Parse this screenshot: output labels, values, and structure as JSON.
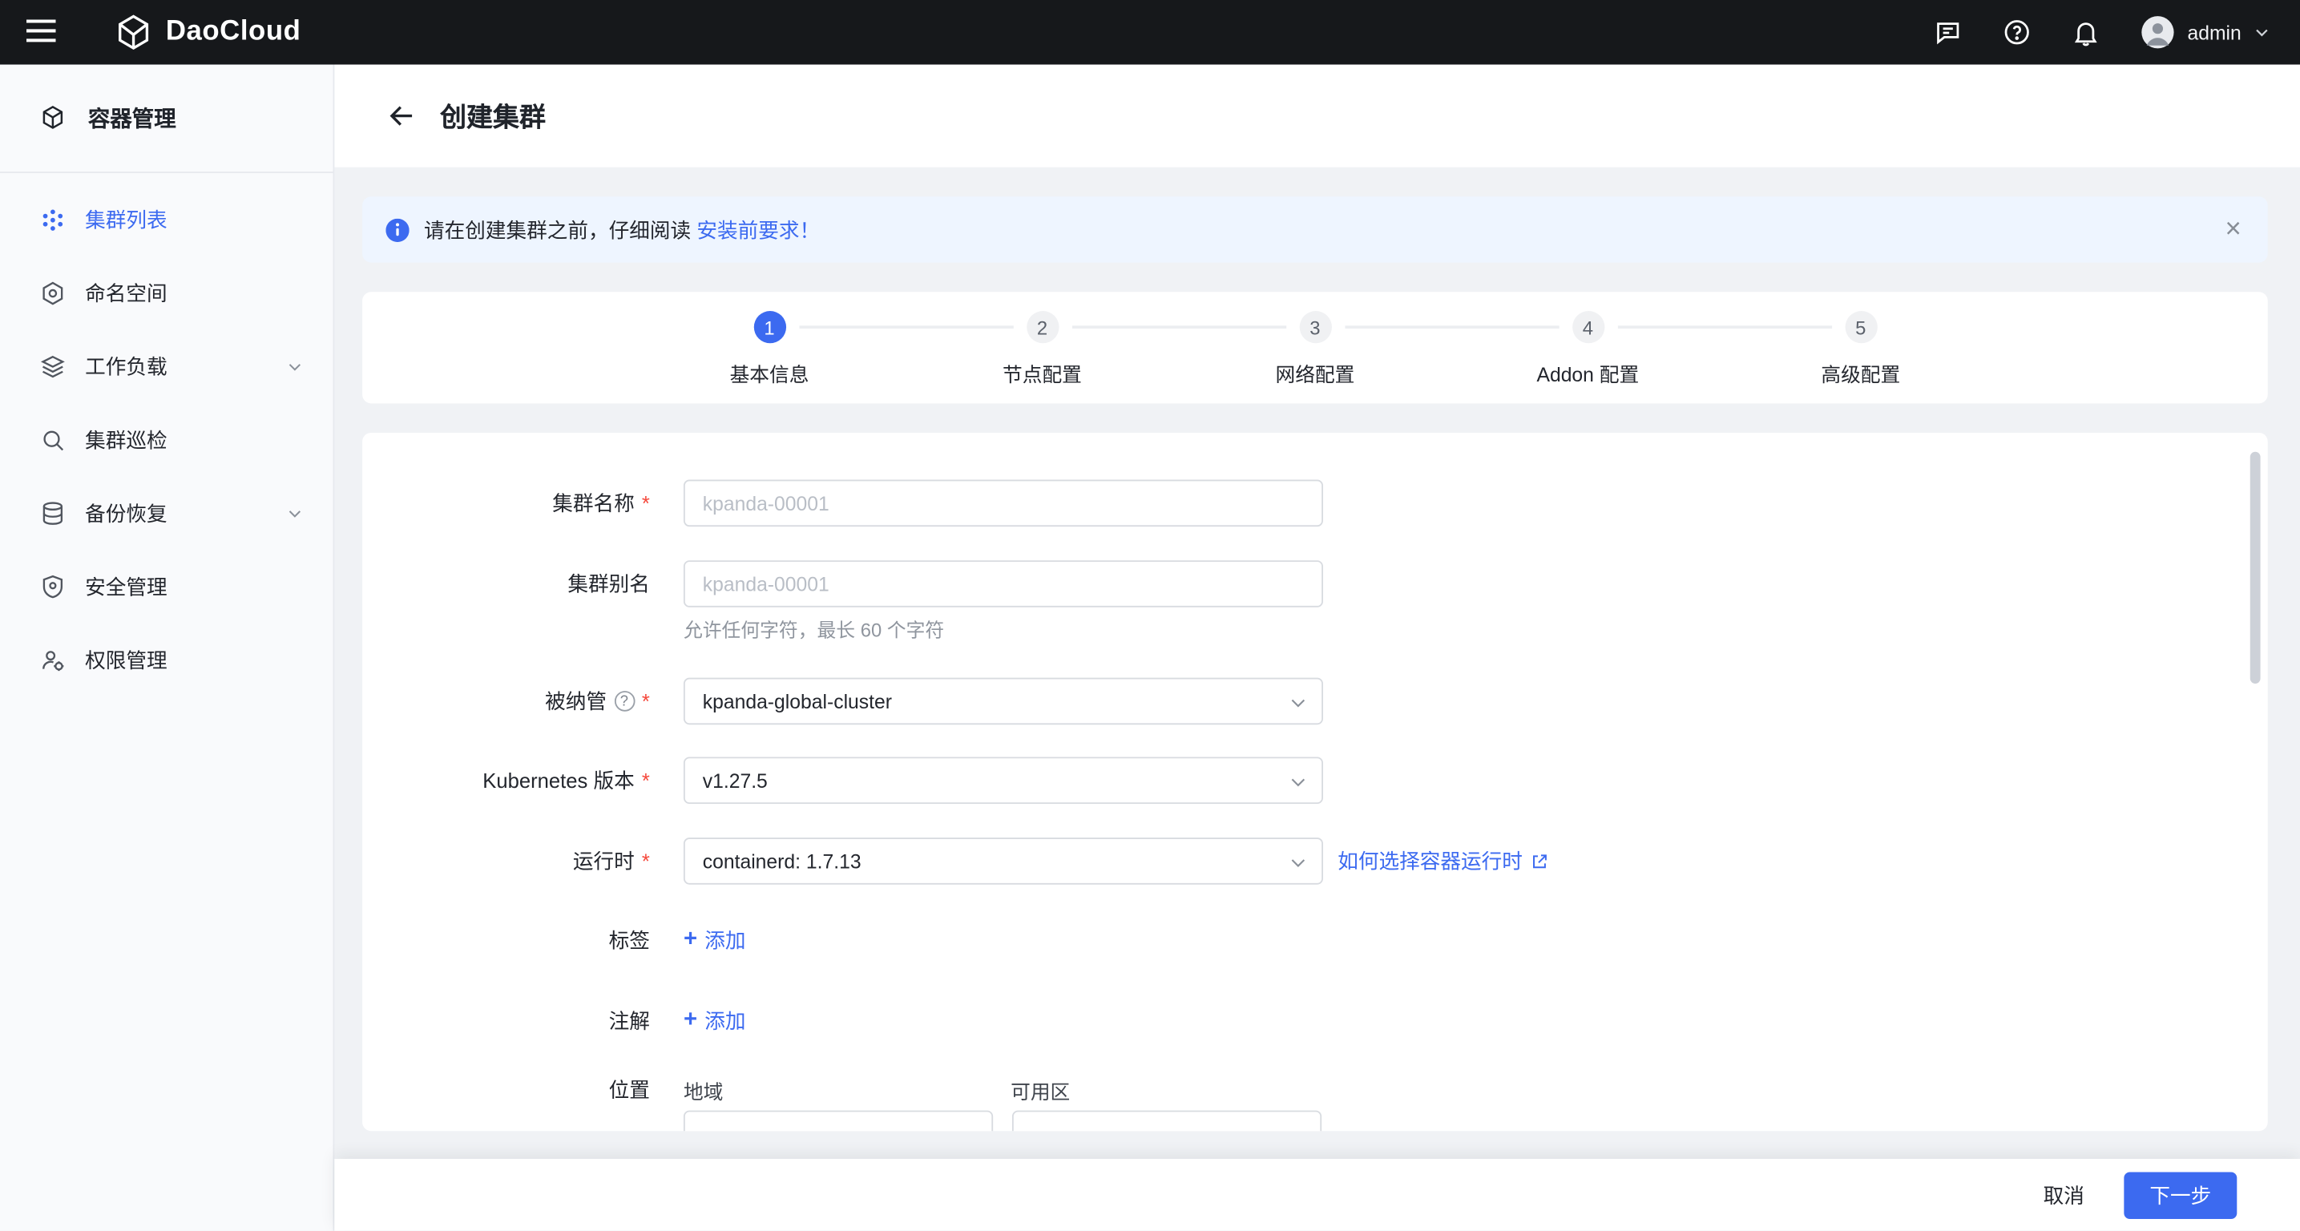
{
  "topbar": {
    "brand": "DaoCloud",
    "user": "admin"
  },
  "sidebar": {
    "title": "容器管理",
    "items": [
      {
        "label": "集群列表"
      },
      {
        "label": "命名空间"
      },
      {
        "label": "工作负载"
      },
      {
        "label": "集群巡检"
      },
      {
        "label": "备份恢复"
      },
      {
        "label": "安全管理"
      },
      {
        "label": "权限管理"
      }
    ]
  },
  "page": {
    "title": "创建集群"
  },
  "alert": {
    "text": "请在创建集群之前，仔细阅读",
    "link": "安装前要求！"
  },
  "steps": [
    {
      "num": "1",
      "label": "基本信息"
    },
    {
      "num": "2",
      "label": "节点配置"
    },
    {
      "num": "3",
      "label": "网络配置"
    },
    {
      "num": "4",
      "label": "Addon 配置"
    },
    {
      "num": "5",
      "label": "高级配置"
    }
  ],
  "form": {
    "cluster_name_label": "集群名称",
    "cluster_name_placeholder": "kpanda-00001",
    "cluster_alias_label": "集群别名",
    "cluster_alias_placeholder": "kpanda-00001",
    "cluster_alias_helper": "允许任何字符，最长 60 个字符",
    "managed_label": "被纳管",
    "managed_value": "kpanda-global-cluster",
    "k8s_version_label": "Kubernetes 版本",
    "k8s_version_value": "v1.27.5",
    "runtime_label": "运行时",
    "runtime_value": "containerd: 1.7.13",
    "runtime_link": "如何选择容器运行时",
    "labels_label": "标签",
    "labels_add": "添加",
    "annotations_label": "注解",
    "annotations_add": "添加",
    "location_label": "位置",
    "region_label": "地域",
    "zone_label": "可用区"
  },
  "footer": {
    "cancel": "取消",
    "next": "下一步"
  },
  "icons": {
    "close": "×",
    "question": "?",
    "plus": "+"
  },
  "colors": {
    "primary": "#3c6af0",
    "topbar_bg": "#16181b",
    "required": "#f5483b",
    "alert_bg": "#eef5ff",
    "sidebar_bg": "#f9fafc",
    "content_bg": "#f0f2f5"
  }
}
